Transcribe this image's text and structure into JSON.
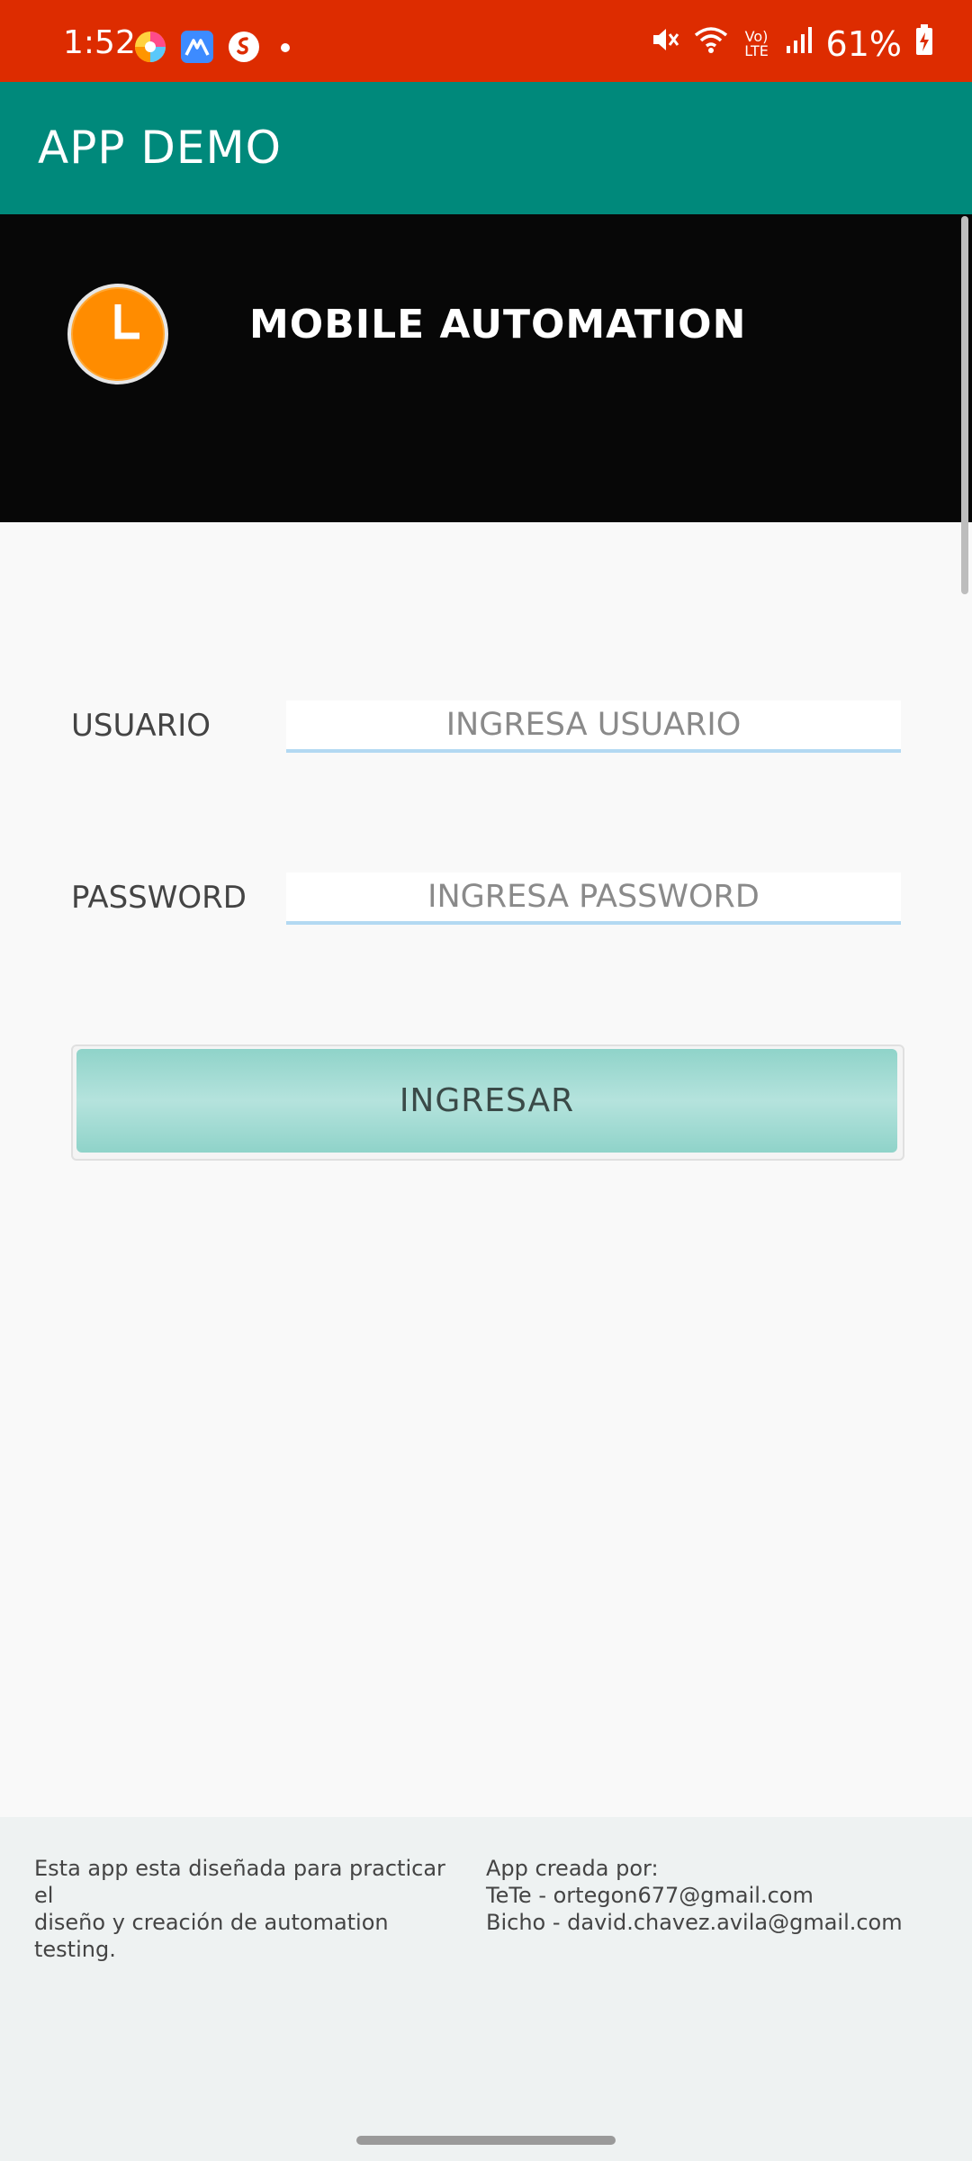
{
  "status_bar": {
    "time": "1:52",
    "battery": "61%",
    "network_label": "Vo) LTE",
    "icons": [
      "colorful-app-icon",
      "maps-app-icon",
      "shazam-icon",
      "mute-icon",
      "wifi-icon",
      "signal-icon",
      "battery-charging-icon"
    ]
  },
  "app_bar": {
    "title": "APP DEMO"
  },
  "banner": {
    "title": "MOBILE AUTOMATION",
    "icon": "clock-icon"
  },
  "form": {
    "user_label": "USUARIO",
    "user_placeholder": "INGRESA USUARIO",
    "user_value": "",
    "password_label": "PASSWORD",
    "password_placeholder": "INGRESA PASSWORD",
    "password_value": "",
    "submit_label": "INGRESAR"
  },
  "footer": {
    "description_line1": "Esta app esta diseñada para practicar el",
    "description_line2": "diseño y creación de automation testing.",
    "credits_heading": "App creada por:",
    "credit_1": "TeTe - ortegon677@gmail.com",
    "credit_2": "Bicho - david.chavez.avila@gmail.com"
  },
  "colors": {
    "status_bar": "#dd2c00",
    "app_bar": "#00897b",
    "banner": "#070707",
    "button": "#8fd3c9",
    "clock": "#ff8c00"
  }
}
